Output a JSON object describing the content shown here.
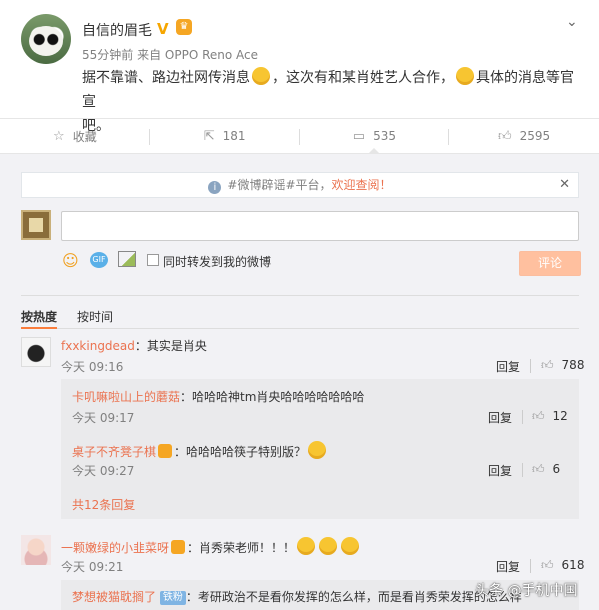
{
  "post": {
    "author": "自信的眉毛",
    "meta": "55分钟前 来自 OPPO Reno Ace",
    "text_1": "据不靠谱、路边社网传消息",
    "text_2": "，这次有和某肖姓艺人合作，",
    "text_3": "具体的消息等官宣",
    "text_4": "吧。"
  },
  "actions": {
    "favorite": "收藏",
    "repost_count": "181",
    "comment_count": "535",
    "like_count": "2595"
  },
  "notice": {
    "tag": "#微博辟谣#平台，",
    "link": "欢迎查阅！"
  },
  "composer": {
    "repost_label": "同时转发到我的微博",
    "submit_label": "评论"
  },
  "sort": {
    "hot": "按热度",
    "time": "按时间"
  },
  "comments": [
    {
      "user": "fxxkingdead",
      "text": "：其实是肖央",
      "time": "今天 09:16",
      "reply": "回复",
      "likes": "788",
      "replies": [
        {
          "user": "卡叽嘛啦山上的蘑菇",
          "text": "：哈哈哈神tm肖央哈哈哈哈哈哈哈",
          "time": "今天 09:17",
          "reply": "回复",
          "likes": "12"
        },
        {
          "user": "桌子不齐凳子棋",
          "text": "：哈哈哈哈筷子特别版？",
          "time": "今天 09:27",
          "reply": "回复",
          "likes": "6"
        }
      ],
      "more": "共12条回复"
    },
    {
      "user": "一颗嫩绿的小韭菜呀",
      "text": "：肖秀荣老师！！！",
      "time": "今天 09:21",
      "reply": "回复",
      "likes": "618",
      "replies": [
        {
          "user": "梦想被猫耽搁了",
          "badge": "铁粉",
          "text": "：考研政治不是看你发挥的怎么样，而是看肖秀荣发挥的怎么样"
        }
      ]
    }
  ],
  "watermark": "头条 @手机中国"
}
